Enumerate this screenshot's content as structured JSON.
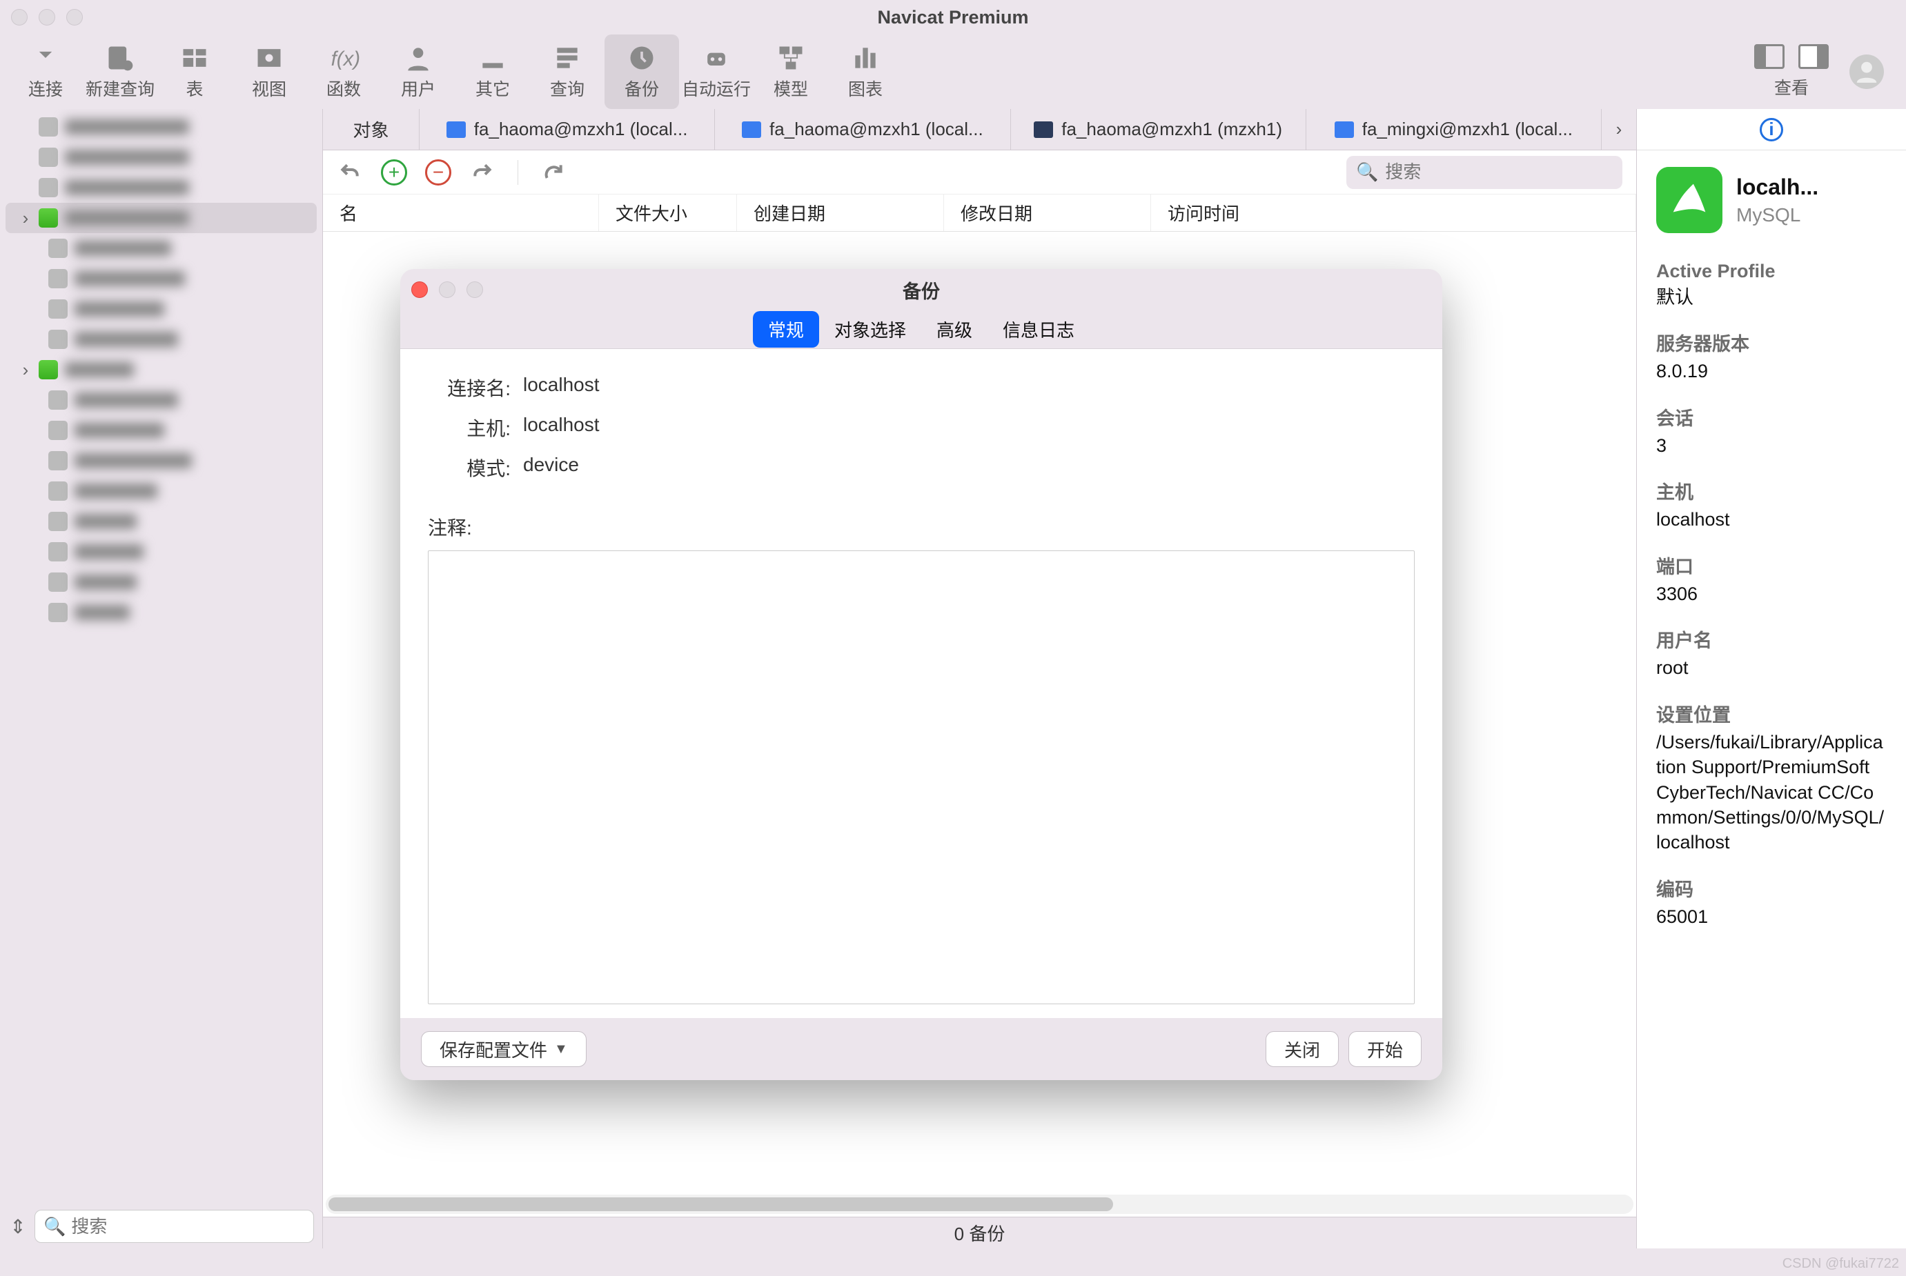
{
  "window": {
    "title": "Navicat Premium"
  },
  "toolbar": {
    "items": [
      {
        "label": "连接",
        "name": "connection"
      },
      {
        "label": "新建查询",
        "name": "new-query"
      },
      {
        "label": "表",
        "name": "table"
      },
      {
        "label": "视图",
        "name": "view"
      },
      {
        "label": "函数",
        "name": "function"
      },
      {
        "label": "用户",
        "name": "user"
      },
      {
        "label": "其它",
        "name": "other"
      },
      {
        "label": "查询",
        "name": "query"
      },
      {
        "label": "备份",
        "name": "backup",
        "active": true
      },
      {
        "label": "自动运行",
        "name": "autorun"
      },
      {
        "label": "模型",
        "name": "model"
      },
      {
        "label": "图表",
        "name": "chart"
      }
    ],
    "right_label": "查看"
  },
  "tabs": {
    "first": "对象",
    "items": [
      {
        "label": "fa_haoma@mzxh1 (local...",
        "icon": "blue"
      },
      {
        "label": "fa_haoma@mzxh1 (local...",
        "icon": "blue"
      },
      {
        "label": "fa_haoma@mzxh1 (mzxh1)",
        "icon": "dark"
      },
      {
        "label": "fa_mingxi@mzxh1 (local...",
        "icon": "blue"
      }
    ]
  },
  "subbar": {
    "search_placeholder": "搜索"
  },
  "columns": {
    "name": "名",
    "size": "文件大小",
    "created": "创建日期",
    "modified": "修改日期",
    "accessed": "访问时间"
  },
  "statusbar": "0 备份",
  "sidebar": {
    "search_placeholder": "搜索"
  },
  "right_panel": {
    "name": "localh...",
    "type": "MySQL",
    "profile_label": "Active Profile",
    "profile_value": "默认",
    "server_version_label": "服务器版本",
    "server_version_value": "8.0.19",
    "sessions_label": "会话",
    "sessions_value": "3",
    "host_label": "主机",
    "host_value": "localhost",
    "port_label": "端口",
    "port_value": "3306",
    "user_label": "用户名",
    "user_value": "root",
    "settings_label": "设置位置",
    "settings_value": "/Users/fukai/Library/Application Support/PremiumSoft CyberTech/Navicat CC/Common/Settings/0/0/MySQL/localhost",
    "encoding_label": "编码",
    "encoding_value": "65001"
  },
  "modal": {
    "title": "备份",
    "tabs": {
      "general": "常规",
      "objects": "对象选择",
      "advanced": "高级",
      "log": "信息日志"
    },
    "fields": {
      "conn_label": "连接名:",
      "conn_value": "localhost",
      "host_label": "主机:",
      "host_value": "localhost",
      "schema_label": "模式:",
      "schema_value": "device",
      "notes_label": "注释:"
    },
    "footer": {
      "save": "保存配置文件",
      "close": "关闭",
      "start": "开始"
    }
  },
  "watermark": "CSDN @fukai7722"
}
